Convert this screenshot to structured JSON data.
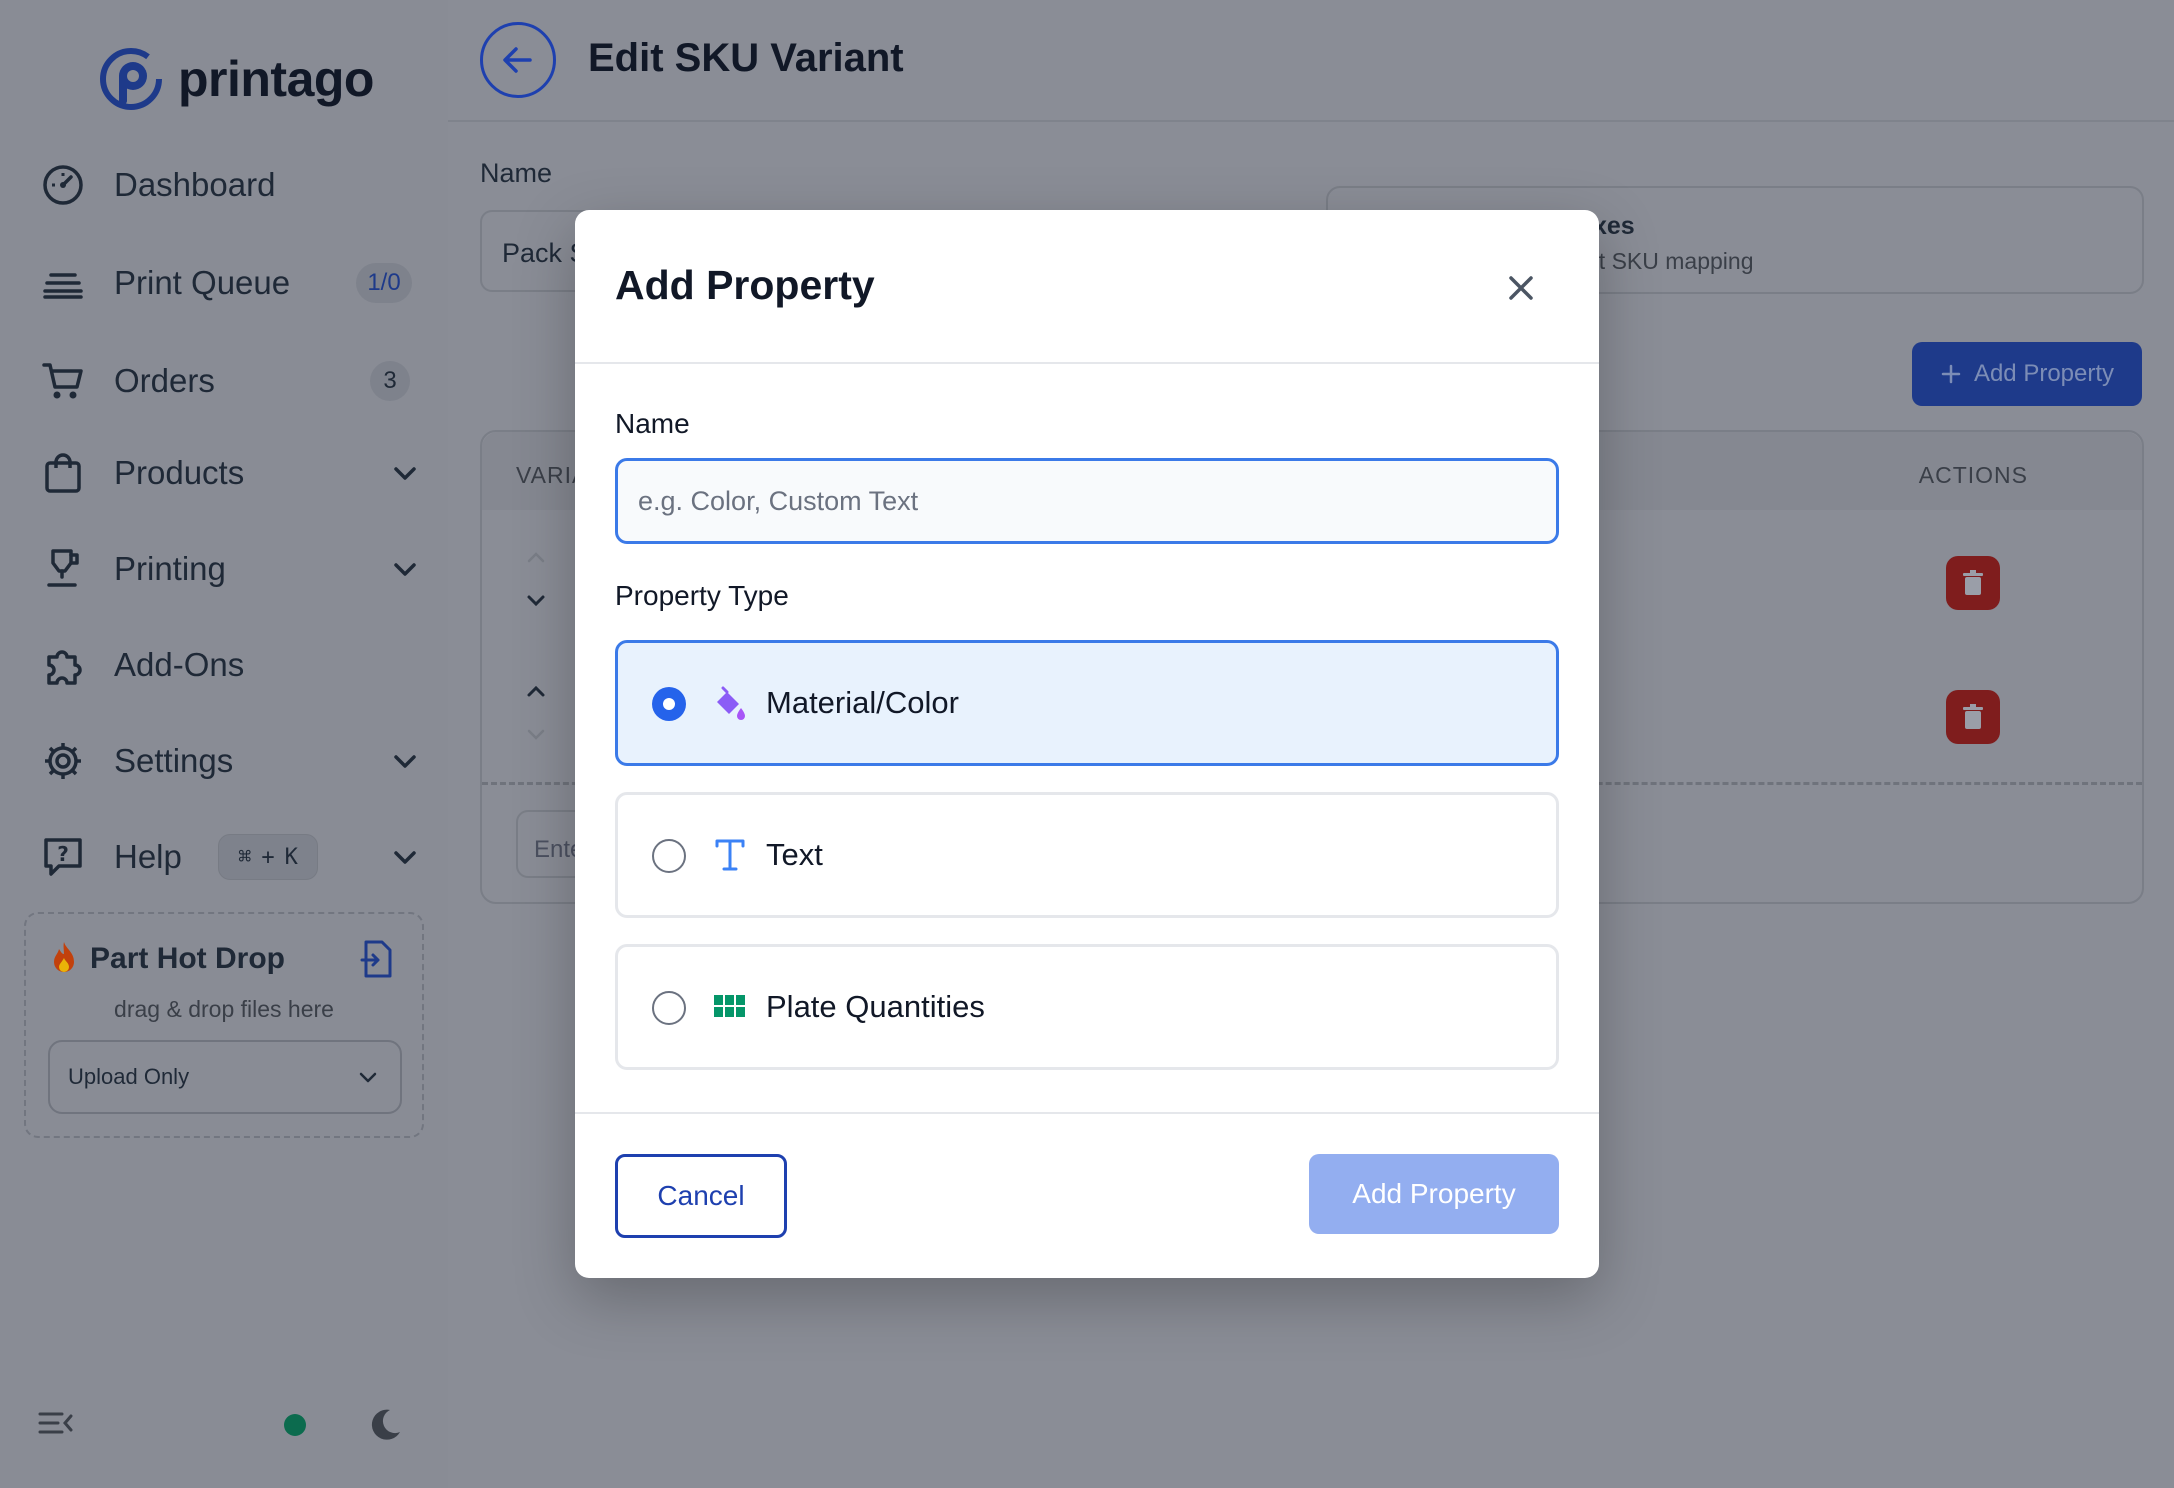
{
  "app": {
    "name": "printago"
  },
  "sidebar": {
    "items": [
      {
        "label": "Dashboard"
      },
      {
        "label": "Print Queue",
        "badge": "1/0"
      },
      {
        "label": "Orders",
        "badge": "3"
      },
      {
        "label": "Products"
      },
      {
        "label": "Printing"
      },
      {
        "label": "Add-Ons"
      },
      {
        "label": "Settings"
      },
      {
        "label": "Help",
        "shortcut_symbol": "⌘",
        "shortcut_plus": "+",
        "shortcut_key": "K"
      }
    ],
    "hot_drop": {
      "title": "Part Hot Drop",
      "subtitle": "drag & drop files here",
      "mode": "Upload Only"
    }
  },
  "page": {
    "title": "Edit SKU Variant",
    "name_label": "Name",
    "name_value": "Pack S",
    "info_title_partial": "ixes",
    "info_sub_partial": "nt SKU mapping",
    "add_property_label": "Add Property",
    "table": {
      "col_left": "VARIA",
      "col_actions": "ACTIONS",
      "enter_placeholder": "Ente"
    }
  },
  "modal": {
    "title": "Add Property",
    "name_label": "Name",
    "name_placeholder": "e.g. Color, Custom Text",
    "type_label": "Property Type",
    "options": [
      {
        "label": "Material/Color",
        "icon": "paint-bucket-icon",
        "selected": true
      },
      {
        "label": "Text",
        "icon": "text-t-icon",
        "selected": false
      },
      {
        "label": "Plate Quantities",
        "icon": "grid-icon",
        "selected": false
      }
    ],
    "cancel_label": "Cancel",
    "submit_label": "Add Property"
  },
  "colors": {
    "accent": "#2563eb",
    "primary_dark": "#1e40af",
    "danger": "#b91c1c",
    "online": "#10b981"
  }
}
